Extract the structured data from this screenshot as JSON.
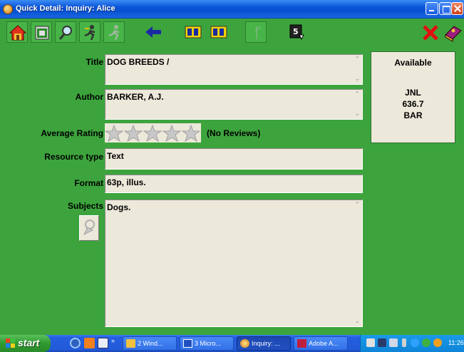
{
  "window": {
    "title": "Quick Detail: Inquiry: Alice"
  },
  "record": {
    "title_label": "Title",
    "title_value": "DOG BREEDS /",
    "author_label": "Author",
    "author_value": "BARKER, A.J.",
    "rating_label": "Average Rating",
    "rating_value": 0,
    "rating_max": 5,
    "rating_text": "(No Reviews)",
    "resource_label": "Resource type",
    "resource_value": "Text",
    "format_label": "Format",
    "format_value": "63p, illus.",
    "subjects_label": "Subjects",
    "subjects_value": "Dogs."
  },
  "availability": {
    "status": "Available",
    "location": "JNL",
    "call_number": "636.7",
    "cutter": "BAR"
  },
  "toolbar": {
    "icons": [
      "home-icon",
      "calendar-icon",
      "search-icon",
      "runner-icon",
      "runner-disabled-icon",
      "back-arrow-icon",
      "film-strip-icon",
      "film-strip-forward-icon",
      "compass-icon",
      "reports-icon",
      "close-icon",
      "book-icon"
    ]
  },
  "taskbar": {
    "start_label": "start",
    "tasks": [
      {
        "label": "2 Wind...",
        "icon": "folder-icon"
      },
      {
        "label": "3 Micro...",
        "icon": "word-icon"
      },
      {
        "label": "Inquiry: ...",
        "icon": "app-icon"
      },
      {
        "label": "Adobe A...",
        "icon": "adobe-icon"
      }
    ],
    "clock": "11:26"
  },
  "colors": {
    "background": "#3da43d",
    "field": "#ece8da",
    "titlebar": "#0a55d8",
    "taskbar": "#245ee0"
  }
}
